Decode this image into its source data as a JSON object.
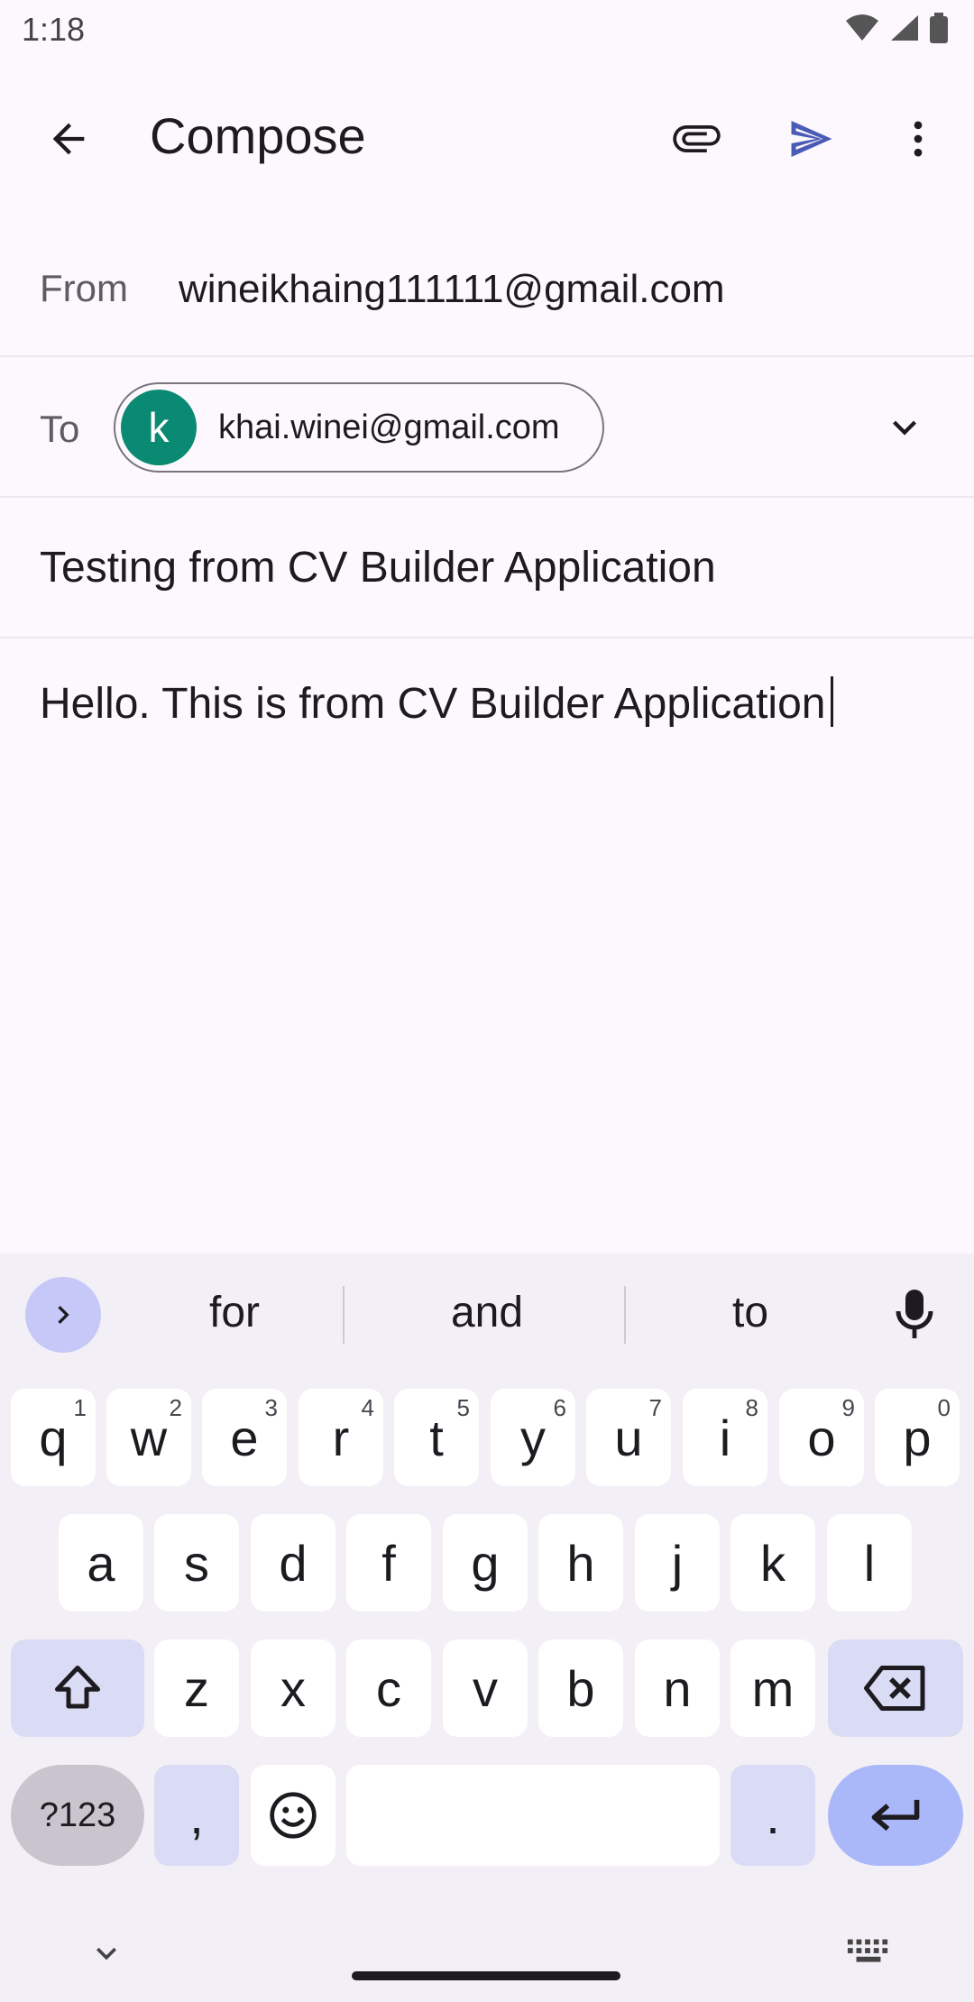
{
  "status_bar": {
    "time": "1:18"
  },
  "app_bar": {
    "title": "Compose"
  },
  "compose": {
    "from_label": "From",
    "from_value": "wineikhaing111111@gmail.com",
    "to_label": "To",
    "recipient_initial": "k",
    "recipient_email": "khai.winei@gmail.com",
    "subject": "Testing from CV Builder Application",
    "body": "Hello. This is from CV Builder Application"
  },
  "keyboard": {
    "suggestions": [
      "for",
      "and",
      "to"
    ],
    "row1": [
      {
        "key": "q",
        "hint": "1"
      },
      {
        "key": "w",
        "hint": "2"
      },
      {
        "key": "e",
        "hint": "3"
      },
      {
        "key": "r",
        "hint": "4"
      },
      {
        "key": "t",
        "hint": "5"
      },
      {
        "key": "y",
        "hint": "6"
      },
      {
        "key": "u",
        "hint": "7"
      },
      {
        "key": "i",
        "hint": "8"
      },
      {
        "key": "o",
        "hint": "9"
      },
      {
        "key": "p",
        "hint": "0"
      }
    ],
    "row2": [
      "a",
      "s",
      "d",
      "f",
      "g",
      "h",
      "j",
      "k",
      "l"
    ],
    "row3": [
      "z",
      "x",
      "c",
      "v",
      "b",
      "n",
      "m"
    ],
    "symbols_label": "?123",
    "comma": ",",
    "period": "."
  },
  "colors": {
    "background": "#fdf8fd",
    "send_accent": "#4a5bb5",
    "avatar": "#0a8a72",
    "keyboard_bg": "#f3eff6",
    "enter_key": "#aab8f9"
  },
  "icons": {
    "back": "arrow-back-icon",
    "attach": "paperclip-icon",
    "send": "send-icon",
    "more": "more-vert-icon",
    "expand": "chevron-down-icon",
    "mic": "mic-icon"
  }
}
